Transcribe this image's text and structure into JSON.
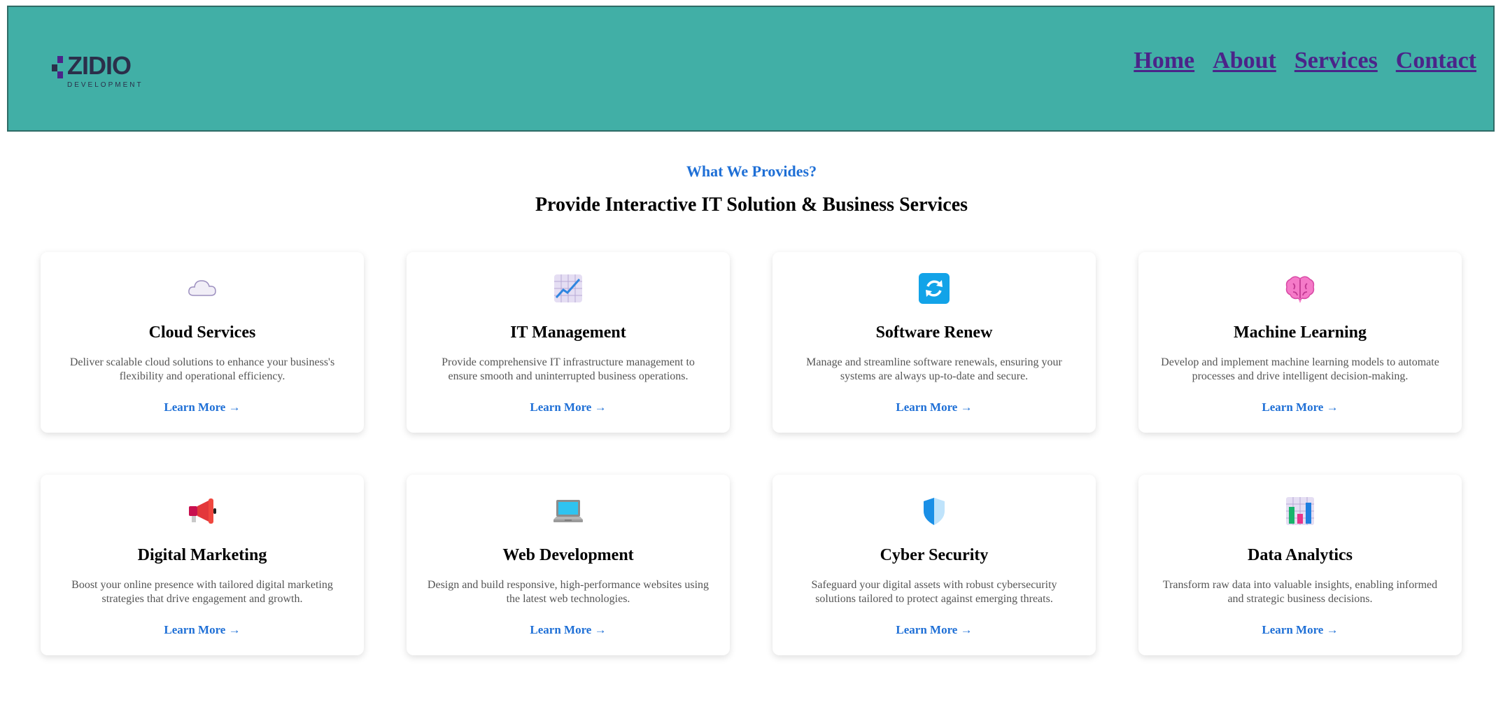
{
  "header": {
    "logo_text": "ZIDIO",
    "logo_sub": "DEVELOPMENT",
    "nav": [
      "Home",
      "About",
      "Services",
      "Contact"
    ]
  },
  "section": {
    "eyebrow": "What We Provides?",
    "headline": "Provide Interactive IT Solution & Business Services"
  },
  "cards": [
    {
      "icon": "cloud-icon",
      "title": "Cloud Services",
      "desc": "Deliver scalable cloud solutions to enhance your business's flexibility and operational efficiency.",
      "link": "Learn More →"
    },
    {
      "icon": "chart-increasing-icon",
      "title": "IT Management",
      "desc": "Provide comprehensive IT infrastructure management to ensure smooth and uninterrupted business operations.",
      "link": "Learn More →"
    },
    {
      "icon": "refresh-icon",
      "title": "Software Renew",
      "desc": "Manage and streamline software renewals, ensuring your systems are always up-to-date and secure.",
      "link": "Learn More →"
    },
    {
      "icon": "brain-icon",
      "title": "Machine Learning",
      "desc": "Develop and implement machine learning models to automate processes and drive intelligent decision-making.",
      "link": "Learn More →"
    },
    {
      "icon": "megaphone-icon",
      "title": "Digital Marketing",
      "desc": "Boost your online presence with tailored digital marketing strategies that drive engagement and growth.",
      "link": "Learn More →"
    },
    {
      "icon": "laptop-icon",
      "title": "Web Development",
      "desc": "Design and build responsive, high-performance websites using the latest web technologies.",
      "link": "Learn More →"
    },
    {
      "icon": "shield-icon",
      "title": "Cyber Security",
      "desc": "Safeguard your digital assets with robust cybersecurity solutions tailored to protect against emerging threats.",
      "link": "Learn More →"
    },
    {
      "icon": "bar-chart-icon",
      "title": "Data Analytics",
      "desc": "Transform raw data into valuable insights, enabling informed and strategic business decisions.",
      "link": "Learn More →"
    }
  ],
  "colors": {
    "header_bg": "#41afa6",
    "nav_link": "#4b2489",
    "accent": "#1e6fd6"
  }
}
